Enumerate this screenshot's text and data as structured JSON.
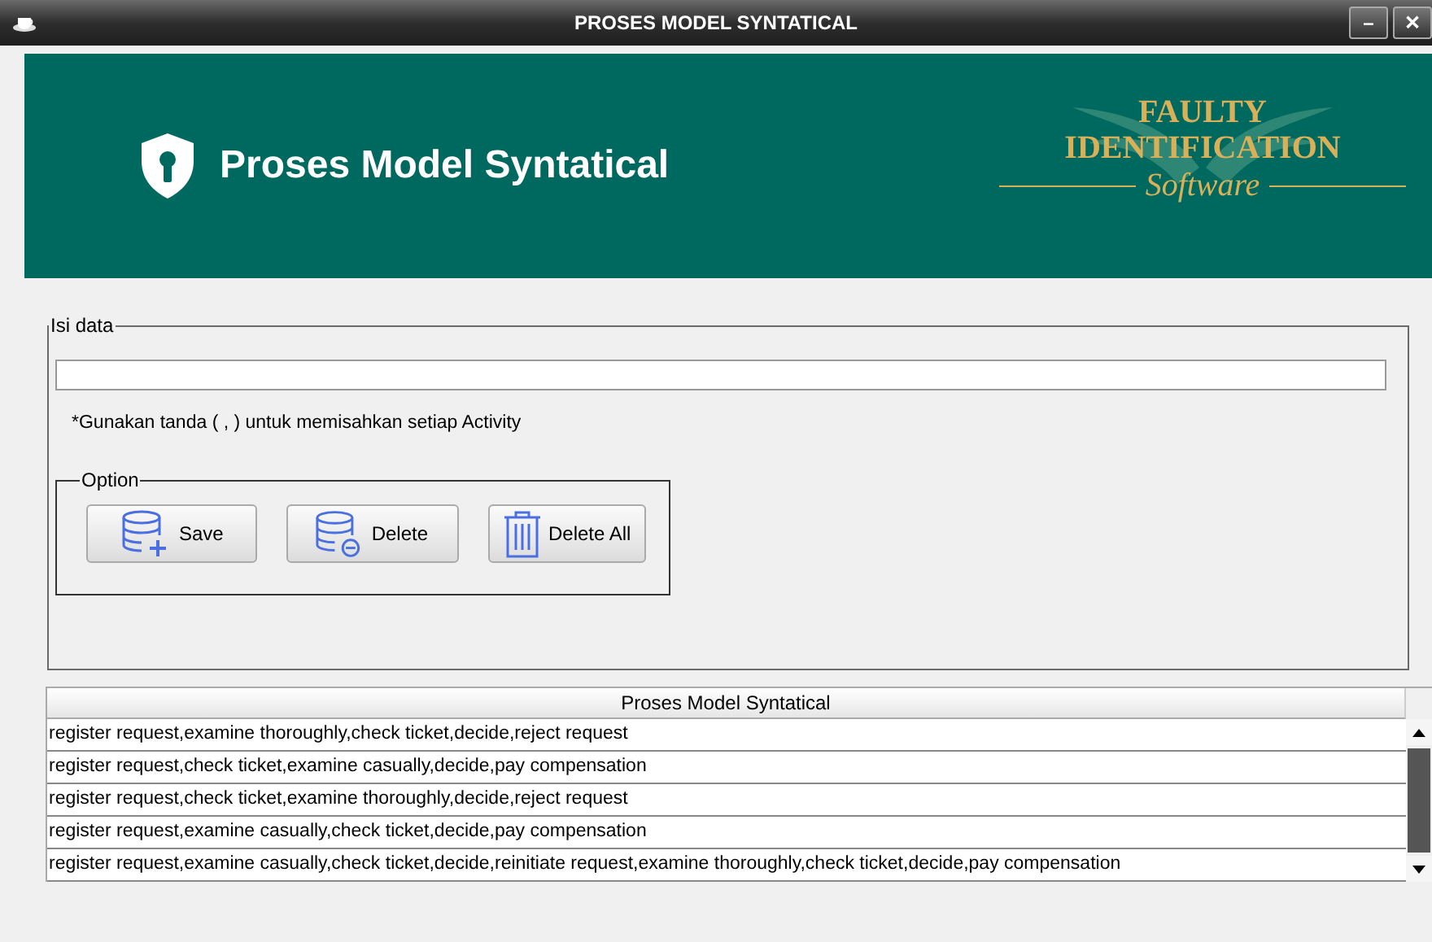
{
  "window": {
    "title": "PROSES MODEL SYNTATICAL",
    "controls": [
      "–",
      "✕"
    ]
  },
  "header": {
    "title": "Proses Model Syntatical",
    "logo": {
      "line_1": "FAULTY",
      "line_2": "IDENTIFICATION",
      "line_3": "Software"
    }
  },
  "form": {
    "group_label": "Isi data",
    "hint": "*Gunakan tanda ( , ) untuk memisahkan setiap Activity",
    "options": {
      "label": "Option",
      "buttons": [
        {
          "kind": "save",
          "label": "Save"
        },
        {
          "kind": "delete",
          "label": "Delete"
        },
        {
          "kind": "delete_all",
          "label": "Delete All"
        }
      ]
    }
  },
  "table": {
    "columns": [
      "Proses Model Syntatical"
    ],
    "rows": [
      [
        "register request,examine thoroughly,check ticket,decide,reject request"
      ],
      [
        "register request,check ticket,examine casually,decide,pay compensation"
      ],
      [
        "register request,check ticket,examine thoroughly,decide,reject request"
      ],
      [
        "register request,examine casually,check ticket,decide,pay compensation"
      ],
      [
        "register request,examine casually,check ticket,decide,reinitiate request,examine thoroughly,check ticket,decide,pay compensation"
      ]
    ]
  }
}
